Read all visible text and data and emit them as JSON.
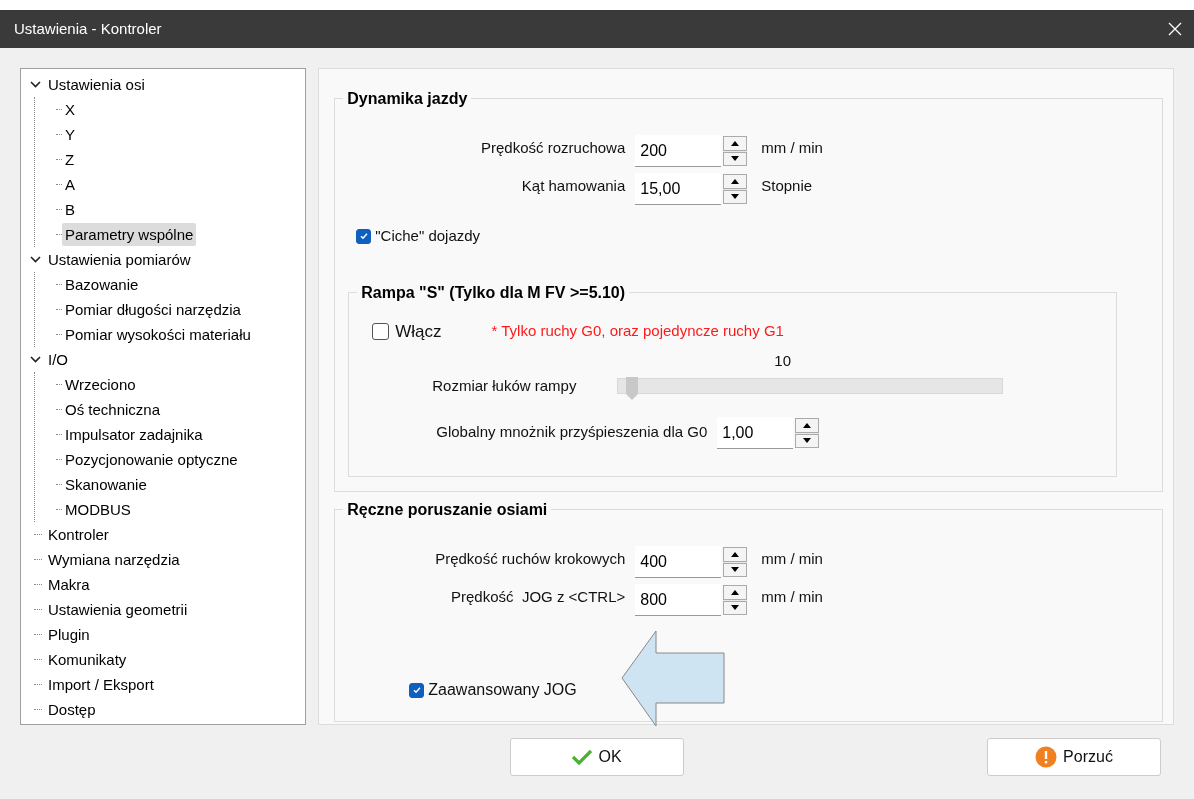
{
  "window": {
    "title": "Ustawienia - Kontroler"
  },
  "tree": [
    {
      "label": "Ustawienia osi",
      "expanded": true,
      "selected": false,
      "children": [
        {
          "label": "X",
          "selected": false
        },
        {
          "label": "Y",
          "selected": false
        },
        {
          "label": "Z",
          "selected": false
        },
        {
          "label": "A",
          "selected": false
        },
        {
          "label": "B",
          "selected": false
        },
        {
          "label": "Parametry wspólne",
          "selected": true
        }
      ]
    },
    {
      "label": "Ustawienia pomiarów",
      "expanded": true,
      "selected": false,
      "children": [
        {
          "label": "Bazowanie",
          "selected": false
        },
        {
          "label": "Pomiar długości narzędzia",
          "selected": false
        },
        {
          "label": "Pomiar wysokości materiału",
          "selected": false
        }
      ]
    },
    {
      "label": "I/O",
      "expanded": true,
      "selected": false,
      "children": [
        {
          "label": "Wrzeciono",
          "selected": false
        },
        {
          "label": "Oś techniczna",
          "selected": false
        },
        {
          "label": "Impulsator zadajnika",
          "selected": false
        },
        {
          "label": "Pozycjonowanie optyczne",
          "selected": false
        },
        {
          "label": "Skanowanie",
          "selected": false
        },
        {
          "label": "MODBUS",
          "selected": false
        }
      ]
    },
    {
      "label": "Kontroler",
      "selected": false
    },
    {
      "label": "Wymiana narzędzia",
      "selected": false
    },
    {
      "label": "Makra",
      "selected": false
    },
    {
      "label": "Ustawienia geometrii",
      "selected": false
    },
    {
      "label": "Plugin",
      "selected": false
    },
    {
      "label": "Komunikaty",
      "selected": false
    },
    {
      "label": "Import / Eksport",
      "selected": false
    },
    {
      "label": "Dostęp",
      "selected": false
    }
  ],
  "dynamics": {
    "title": "Dynamika jazdy",
    "fields": [
      {
        "label": "Prędkość rozruchowa",
        "value": "200",
        "unit": "mm / min"
      },
      {
        "label": "Kąt hamowania",
        "value": "15,00",
        "unit": "Stopnie"
      }
    ],
    "checkbox": {
      "label": "\"Ciche\" dojazdy",
      "checked": true
    }
  },
  "ramp": {
    "title": "Rampa \"S\" (Tylko dla M FV >=5.10)",
    "enable": {
      "label": "Włącz",
      "checked": false
    },
    "note": "* Tylko ruchy G0, oraz pojedyncze ruchy G1",
    "slider": {
      "label": "Rozmiar łuków rampy",
      "reading": "10",
      "level": 0.02
    },
    "multiplier": {
      "label": "Globalny mnożnik przyśpieszenia dla G0",
      "value": "1,00"
    }
  },
  "manual": {
    "title": "Ręczne poruszanie osiami",
    "fields": [
      {
        "label": "Prędkość ruchów krokowych",
        "value": "400",
        "unit": "mm / min"
      },
      {
        "label": "Prędkość  JOG z <CTRL>",
        "value": "800",
        "unit": "mm / min"
      }
    ],
    "checkbox": {
      "label": "Zaawansowany JOG",
      "checked": true
    }
  },
  "buttons": [
    {
      "label": "OK",
      "kind": "ok"
    },
    {
      "label": "Porzuć",
      "kind": "cancel"
    }
  ]
}
